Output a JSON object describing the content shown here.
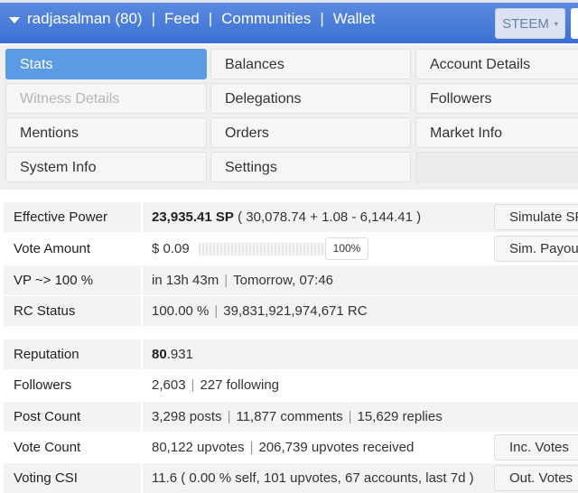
{
  "topbar": {
    "user": "radjasalman (80)",
    "links": [
      "Feed",
      "Communities",
      "Wallet"
    ],
    "separator": "|",
    "chain_selector": "STEEM"
  },
  "tabs": [
    {
      "label": "Stats",
      "state": "active"
    },
    {
      "label": "Balances",
      "state": "normal"
    },
    {
      "label": "Account Details",
      "state": "normal"
    },
    {
      "label": "Witness Details",
      "state": "disabled"
    },
    {
      "label": "Delegations",
      "state": "normal"
    },
    {
      "label": "Followers",
      "state": "normal"
    },
    {
      "label": "Mentions",
      "state": "normal"
    },
    {
      "label": "Orders",
      "state": "normal"
    },
    {
      "label": "Market Info",
      "state": "normal"
    },
    {
      "label": "System Info",
      "state": "normal"
    },
    {
      "label": "Settings",
      "state": "normal"
    }
  ],
  "stats": {
    "effective_power": {
      "label": "Effective Power",
      "sp": "23,935.41 SP",
      "breakdown": "( 30,078.74 + 1.08 - 6,144.41 )",
      "button": "Simulate SP"
    },
    "vote_amount": {
      "label": "Vote Amount",
      "value": "$ 0.09",
      "weight": "100%",
      "weight_fraction": 1.0,
      "button": "Sim. Payout"
    },
    "vp": {
      "label": "VP ~> 100 %",
      "in_time": "in 13h 43m",
      "when": "Tomorrow, 07:46"
    },
    "rc": {
      "label": "RC Status",
      "percent": "100.00 %",
      "amount": "39,831,921,974,671 RC"
    },
    "reputation": {
      "label": "Reputation",
      "int": "80",
      "dec": ".931"
    },
    "followers": {
      "label": "Followers",
      "count": "2,603",
      "following": "227 following"
    },
    "post_count": {
      "label": "Post Count",
      "posts": "3,298 posts",
      "comments": "11,877 comments",
      "replies": "15,629 replies"
    },
    "vote_count": {
      "label": "Vote Count",
      "upvotes": "80,122 upvotes",
      "received": "206,739 upvotes received",
      "button": "Inc. Votes"
    },
    "voting_csi": {
      "label": "Voting CSI",
      "value": "11.6 ( 0.00 % self, 101 upvotes, 67 accounts, last 7d )",
      "button": "Out. Votes"
    }
  },
  "colors": {
    "topbar": "#4a7fdc",
    "active_tab": "#5b9be6"
  }
}
